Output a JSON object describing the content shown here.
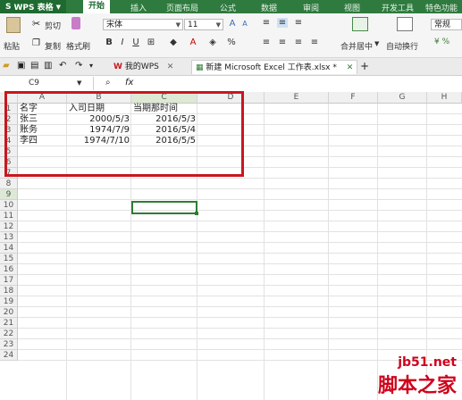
{
  "app": {
    "name": "WPS 表格"
  },
  "menu_tabs": [
    "开始",
    "插入",
    "页面布局",
    "公式",
    "数据",
    "审阅",
    "视图",
    "开发工具",
    "特色功能"
  ],
  "ribbon": {
    "cut": "剪切",
    "paste": "粘贴",
    "copy": "复制",
    "format_painter": "格式刷",
    "font_name": "宋体",
    "font_size": "11",
    "merge_center": "合并居中",
    "wrap_text": "自动换行",
    "number_format": "常规"
  },
  "doc_tabs": [
    {
      "label": "我的WPS"
    },
    {
      "label": "新建 Microsoft Excel 工作表.xlsx *"
    }
  ],
  "formula_bar": {
    "name_box": "C9",
    "fx": "fx"
  },
  "columns": [
    "A",
    "B",
    "C",
    "D",
    "E",
    "F",
    "G",
    "H"
  ],
  "rows": [
    "1",
    "2",
    "3",
    "4",
    "5",
    "6",
    "7",
    "8",
    "9",
    "10",
    "11",
    "12",
    "13",
    "14",
    "15",
    "16",
    "17",
    "18",
    "19",
    "20",
    "21",
    "22",
    "23",
    "24"
  ],
  "cells": [
    {
      "row": 1,
      "col": "A",
      "value": "名字"
    },
    {
      "row": 1,
      "col": "B",
      "value": "入司日期"
    },
    {
      "row": 1,
      "col": "C",
      "value": "当期那时间"
    },
    {
      "row": 2,
      "col": "A",
      "value": "张三"
    },
    {
      "row": 2,
      "col": "B",
      "value": "2000/5/3"
    },
    {
      "row": 2,
      "col": "C",
      "value": "2016/5/3"
    },
    {
      "row": 3,
      "col": "A",
      "value": "账务"
    },
    {
      "row": 3,
      "col": "B",
      "value": "1974/7/9"
    },
    {
      "row": 3,
      "col": "C",
      "value": "2016/5/4"
    },
    {
      "row": 4,
      "col": "A",
      "value": "李四"
    },
    {
      "row": 4,
      "col": "B",
      "value": "1974/7/10"
    },
    {
      "row": 4,
      "col": "C",
      "value": "2016/5/5"
    }
  ],
  "selected_cell": "C9",
  "watermark": {
    "url": "jb51.net",
    "name": "脚本之家"
  }
}
